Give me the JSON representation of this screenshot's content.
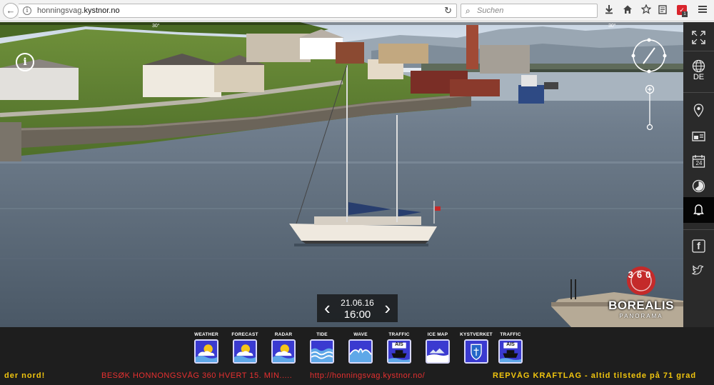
{
  "browser": {
    "url_domain": "honningsvag",
    "url_rest": ".kystnor.no",
    "search_placeholder": "Suchen"
  },
  "viewport": {
    "ruler_marks": [
      "30°",
      "30°"
    ],
    "info_button": "i",
    "date": "21.06.16",
    "time": "16:00",
    "logo": {
      "number": "360",
      "name": "BOREALIS",
      "sub": "PANORAMA"
    }
  },
  "sidebar": {
    "language": "DE",
    "items": [
      "fullscreen-icon",
      "globe-icon",
      "map-pin-icon",
      "card-icon",
      "calendar-icon",
      "timelapse-icon",
      "notification-icon",
      "facebook-icon",
      "twitter-icon"
    ],
    "calendar_day": "24",
    "facebook_letter": "f"
  },
  "tools": [
    {
      "label": "WEATHER",
      "icon": "weather-icon"
    },
    {
      "label": "FORECAST",
      "icon": "forecast-icon"
    },
    {
      "label": "RADAR",
      "icon": "radar-icon"
    },
    {
      "label": "TIDE",
      "icon": "tide-icon"
    },
    {
      "label": "WAVE",
      "icon": "wave-icon"
    },
    {
      "label": "TRAFFIC",
      "icon": "ais-traffic-icon",
      "badge": "AIS"
    },
    {
      "label": "ICE MAP",
      "icon": "ice-map-icon"
    },
    {
      "label": "KYSTVERKET",
      "icon": "kystverket-icon"
    },
    {
      "label": "TRAFFIC",
      "icon": "ais-traffic-icon",
      "badge": "AIS"
    }
  ],
  "ticker": {
    "part1": "der nord!",
    "part2": "BESØK HONNONGSVÅG 360 HVERT 15. MIN.....",
    "part3": "http://honningsvag.kystnor.no/",
    "part4": "REPVÅG KRAFTLAG - altid tilstede på 71 grad"
  },
  "colors": {
    "ticker_yellow": "#f2c60e",
    "ticker_red": "#e83030",
    "tool_blue": "#3838c8",
    "sidebar_bg": "#2a2a2a"
  }
}
